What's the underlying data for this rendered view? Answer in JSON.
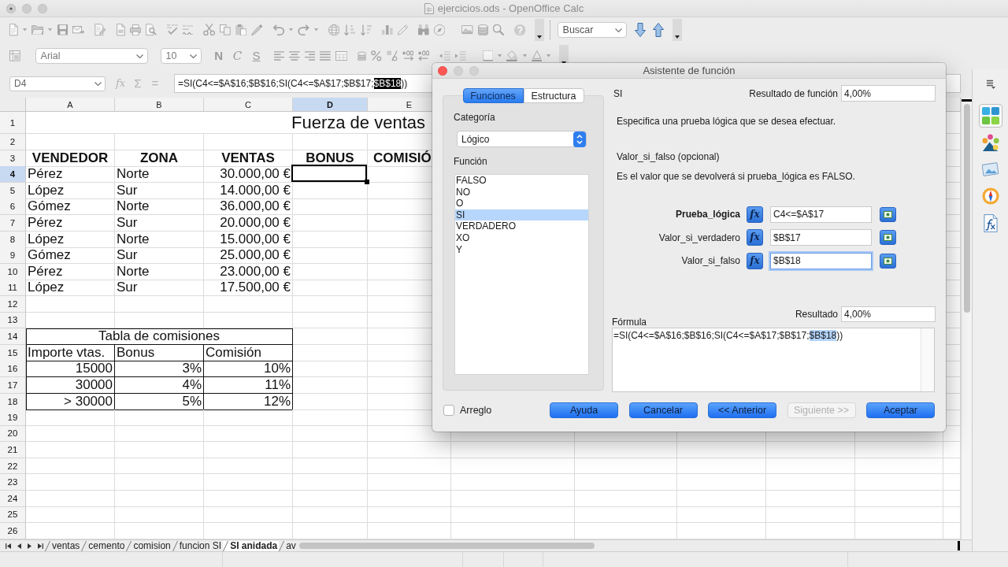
{
  "window": {
    "title": "ejercicios.ods - OpenOffice Calc"
  },
  "toolbar": {
    "search": {
      "placeholder": "Buscar"
    }
  },
  "format_toolbar": {
    "font_name": "Arial",
    "font_size": "10",
    "style_buttons": [
      "N",
      "C",
      "S"
    ]
  },
  "formula_bar": {
    "name_box": "D4",
    "buttons": [
      {
        "label": "fx",
        "disabled": true
      },
      {
        "label": "Σ",
        "disabled": true
      },
      {
        "label": "=",
        "disabled": true
      }
    ],
    "formula": {
      "text_before": "=SI(C4<=$A$16;$B$16;SI(C4<=$A$17;$B$17;",
      "selection": "$B$18",
      "text_after": "))"
    }
  },
  "sidebar_tabs": [
    {
      "selected": true
    },
    {
      "selected": false
    },
    {
      "selected": false
    },
    {
      "selected": false
    },
    {
      "selected": false
    }
  ],
  "sheet": {
    "columns": [
      {
        "label": "A",
        "selected": false
      },
      {
        "label": "B",
        "selected": false
      },
      {
        "label": "C",
        "selected": false
      },
      {
        "label": "D",
        "selected": true
      },
      {
        "label": "E",
        "selected": false
      }
    ],
    "rows": [
      {
        "number": "1",
        "selected": false,
        "kind": "title",
        "text": "Fuerza de ventas"
      },
      {
        "number": "2",
        "selected": false
      },
      {
        "number": "3",
        "selected": false,
        "kind": "heading",
        "cells": [
          "VENDEDOR",
          "ZONA",
          "VENTAS",
          "BONUS",
          "COMISIÓ"
        ]
      },
      {
        "number": "4",
        "selected": true,
        "kind": "data",
        "cells": [
          "Pérez",
          "Norte",
          "30.000,00 €"
        ]
      },
      {
        "number": "5",
        "selected": false,
        "kind": "data",
        "cells": [
          "López",
          "Sur",
          "14.000,00 €"
        ]
      },
      {
        "number": "6",
        "selected": false,
        "kind": "data",
        "cells": [
          "Gómez",
          "Norte",
          "36.000,00 €"
        ]
      },
      {
        "number": "7",
        "selected": false,
        "kind": "data",
        "cells": [
          "Pérez",
          "Sur",
          "20.000,00 €"
        ]
      },
      {
        "number": "8",
        "selected": false,
        "kind": "data",
        "cells": [
          "López",
          "Norte",
          "15.000,00 €"
        ]
      },
      {
        "number": "9",
        "selected": false,
        "kind": "data",
        "cells": [
          "Gómez",
          "Sur",
          "25.000,00 €"
        ]
      },
      {
        "number": "10",
        "selected": false,
        "kind": "data",
        "cells": [
          "Pérez",
          "Norte",
          "23.000,00 €"
        ]
      },
      {
        "number": "11",
        "selected": false,
        "kind": "data",
        "cells": [
          "López",
          "Sur",
          "17.500,00 €"
        ]
      },
      {
        "number": "12",
        "selected": false
      },
      {
        "number": "13",
        "selected": false
      },
      {
        "number": "14",
        "selected": false,
        "kind": "table_title",
        "text": "Tabla de comisiones"
      },
      {
        "number": "15",
        "selected": false,
        "kind": "table_heading",
        "cells": [
          "Importe vtas.",
          "Bonus",
          "Comisión"
        ]
      },
      {
        "number": "16",
        "selected": false,
        "kind": "table_row",
        "cells": [
          "15000",
          "3%",
          "10%"
        ]
      },
      {
        "number": "17",
        "selected": false,
        "kind": "table_row",
        "cells": [
          "30000",
          "4%",
          "11%"
        ]
      },
      {
        "number": "18",
        "selected": false,
        "kind": "table_row",
        "cells": [
          "> 30000",
          "5%",
          "12%"
        ]
      },
      {
        "number": "19",
        "selected": false
      },
      {
        "number": "20",
        "selected": false
      },
      {
        "number": "21",
        "selected": false
      },
      {
        "number": "22",
        "selected": false
      },
      {
        "number": "23",
        "selected": false
      },
      {
        "number": "24",
        "selected": false
      },
      {
        "number": "25",
        "selected": false
      },
      {
        "number": "26",
        "selected": false
      }
    ]
  },
  "sheet_tabs": [
    {
      "label": "ventas",
      "selected": false
    },
    {
      "label": "cemento",
      "selected": false
    },
    {
      "label": "comision",
      "selected": false
    },
    {
      "label": "funcion SI",
      "selected": false
    },
    {
      "label": "SI anidada",
      "selected": true
    },
    {
      "label": "av",
      "selected": false
    }
  ],
  "dialog": {
    "title": "Asistente de función",
    "tabs": [
      {
        "label": "Funciones",
        "selected": true
      },
      {
        "label": "Estructura",
        "selected": false
      }
    ],
    "category_label": "Categoría",
    "category": "Lógico",
    "function_label": "Función",
    "functions": [
      {
        "label": "FALSO",
        "selected": false
      },
      {
        "label": "NO",
        "selected": false
      },
      {
        "label": "O",
        "selected": false
      },
      {
        "label": "SI",
        "selected": true
      },
      {
        "label": "VERDADERO",
        "selected": false
      },
      {
        "label": "XO",
        "selected": false
      },
      {
        "label": "Y",
        "selected": false
      }
    ],
    "function_name": "SI",
    "function_result_label": "Resultado de función",
    "function_result": "4,00%",
    "description": "Especifica una prueba lógica que se desea efectuar.",
    "argument_name": "Valor_si_falso (opcional)",
    "argument_description": "Es el valor que se devolverá si prueba_lógica es FALSO.",
    "arguments": [
      {
        "label": "Prueba_lógica",
        "required": true,
        "button": "fx",
        "value": "C4<=$A$17",
        "focused": false
      },
      {
        "label": "Valor_si_verdadero",
        "required": false,
        "button": "fx",
        "value": "$B$17",
        "focused": false
      },
      {
        "label": "Valor_si_falso",
        "required": false,
        "button": "fx",
        "value": "$B$18",
        "focused": true
      }
    ],
    "formula_label": "Fórmula",
    "result_label": "Resultado",
    "result": "4,00%",
    "formula": {
      "text_before": "=SI(C4<=$A$16;$B$16;SI(C4<=$A$17;$B$17;",
      "selection": "$B$18",
      "text_after": "))"
    },
    "array": {
      "label": "Arreglo",
      "checked": false
    },
    "buttons": [
      {
        "label": "Ayuda",
        "disabled": false
      },
      {
        "label": "Cancelar",
        "disabled": false
      },
      {
        "label": "<< Anterior",
        "disabled": false
      },
      {
        "label": "Siguiente >>",
        "disabled": true
      },
      {
        "label": "Aceptar",
        "disabled": false
      }
    ]
  }
}
